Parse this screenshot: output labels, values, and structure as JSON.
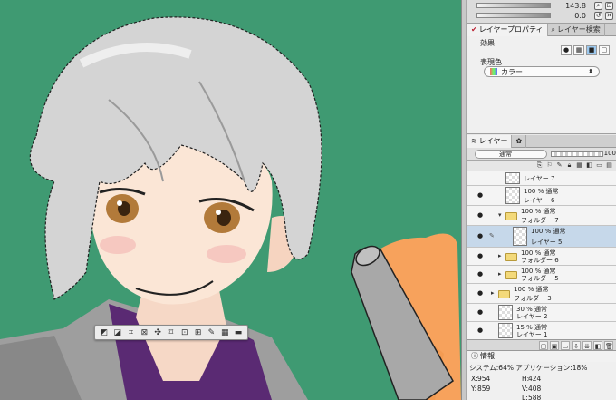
{
  "navigator": {
    "zoom": "143.8",
    "rotation": "0.0"
  },
  "tabs_top": [
    {
      "label": "レイヤープロパティ",
      "active": true
    },
    {
      "label": "レイヤー検索",
      "active": false
    }
  ],
  "properties": {
    "effect_label": "効果",
    "display_color_label": "表現色",
    "display_color_value": "カラー"
  },
  "tabs_layer": [
    {
      "label": "レイヤー",
      "active": true
    }
  ],
  "layer_panel": {
    "blend_mode": "通常",
    "opacity": "100"
  },
  "layers": [
    {
      "line1": "",
      "line2": "レイヤー 7",
      "kind": "layer",
      "visible": false,
      "selected": false,
      "indent": 1
    },
    {
      "line1": "100 % 通常",
      "line2": "レイヤー 6",
      "kind": "layer",
      "visible": true,
      "selected": false,
      "indent": 1
    },
    {
      "line1": "100 % 通常",
      "line2": "フォルダー 7",
      "kind": "folder-open",
      "visible": true,
      "selected": false,
      "indent": 1
    },
    {
      "line1": "100 % 通常",
      "line2": "レイヤー 5",
      "kind": "layer",
      "visible": true,
      "selected": true,
      "indent": 2
    },
    {
      "line1": "100 % 通常",
      "line2": "フォルダー 6",
      "kind": "folder",
      "visible": true,
      "selected": false,
      "indent": 1
    },
    {
      "line1": "100 % 通常",
      "line2": "フォルダー 5",
      "kind": "folder",
      "visible": true,
      "selected": false,
      "indent": 1
    },
    {
      "line1": "100 % 通常",
      "line2": "フォルダー 3",
      "kind": "folder",
      "visible": true,
      "selected": false,
      "indent": 0
    },
    {
      "line1": "30 % 通常",
      "line2": "レイヤー 2",
      "kind": "layer",
      "visible": true,
      "selected": false,
      "indent": 0
    },
    {
      "line1": "15 % 通常",
      "line2": "レイヤー 1",
      "kind": "layer",
      "visible": true,
      "selected": false,
      "indent": 0
    }
  ],
  "info": {
    "tab_label": "情報",
    "system": "システム:64% アプリケーション:18%",
    "x": "954",
    "y": "859",
    "h": "424",
    "v": "408",
    "l": "588"
  },
  "colors": {
    "canvas_bg": "#3f9a72",
    "selected_layer": "#c6d8ea",
    "hair": "#d2d2d2",
    "skin": "#fbe4d3",
    "eyes": "#b27a3a",
    "glove": "#f7a25c"
  },
  "icons": {
    "selection_toolbar": [
      "fill-icon",
      "gradient-icon",
      "crop-icon",
      "transform-icon",
      "scale-icon",
      "free-transform-icon",
      "shrink-icon",
      "grow-icon",
      "brush-selection-icon",
      "checker-icon",
      "mask-icon"
    ]
  }
}
